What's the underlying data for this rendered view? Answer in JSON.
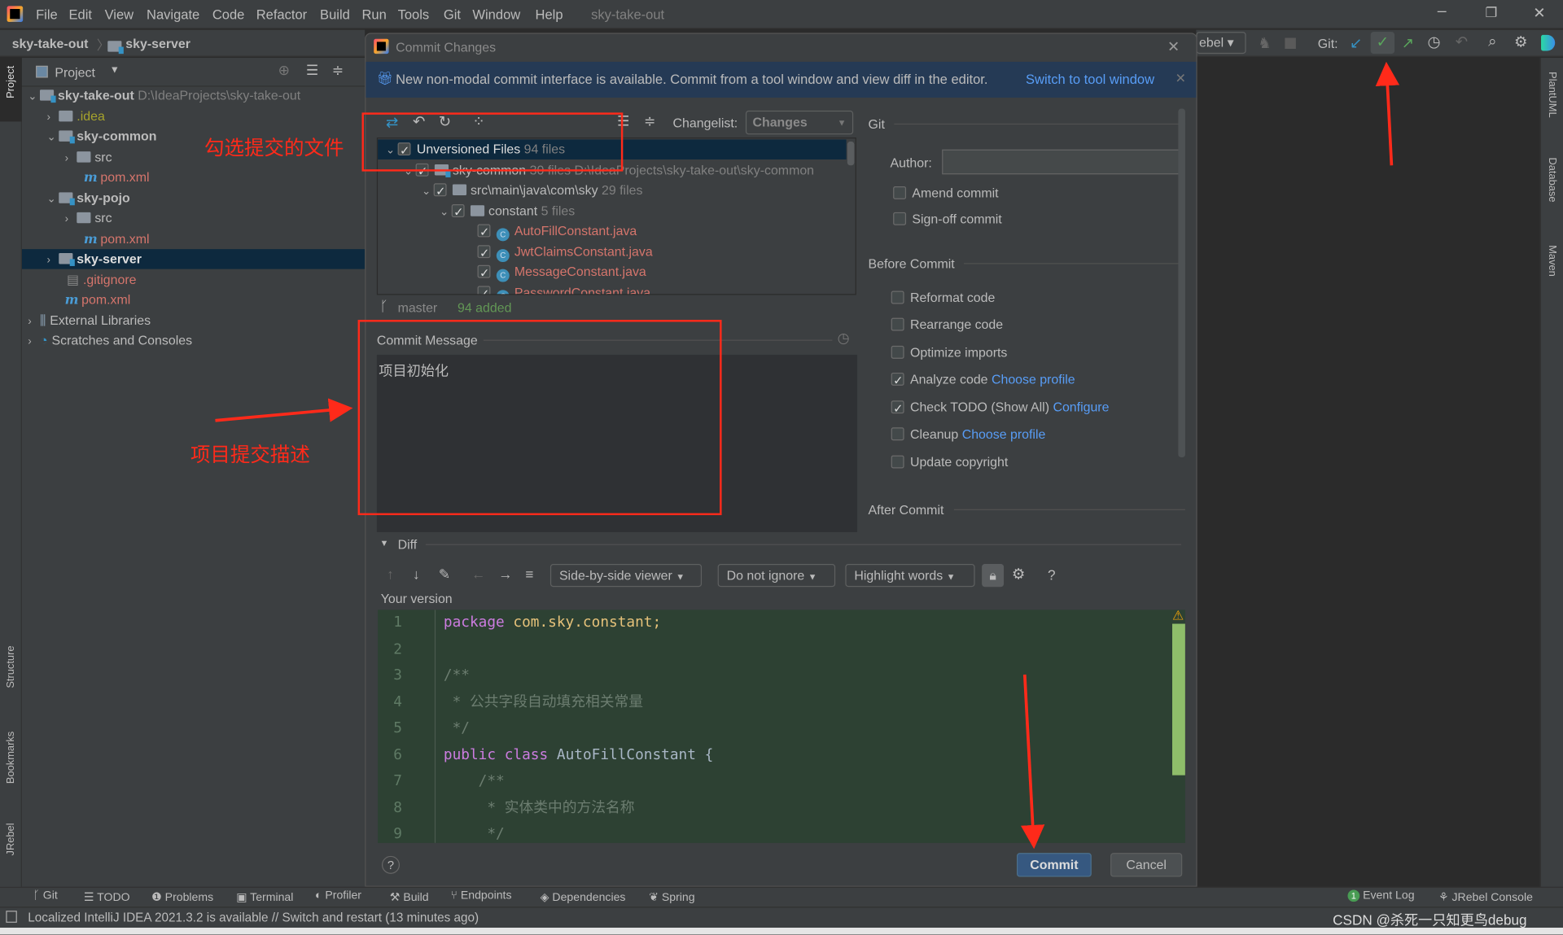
{
  "menubar": {
    "items": [
      "File",
      "Edit",
      "View",
      "Navigate",
      "Code",
      "Refactor",
      "Build",
      "Run",
      "Tools",
      "Git",
      "Window",
      "Help"
    ],
    "project_title": "sky-take-out"
  },
  "breadcrumb": {
    "root": "sky-take-out",
    "module": "sky-server"
  },
  "toolbar": {
    "run_config": "ebel",
    "git_label": "Git:"
  },
  "left_stripe": {
    "project": "Project",
    "structure": "Structure",
    "bookmarks": "Bookmarks",
    "jrebel": "JRebel"
  },
  "right_stripe": {
    "plantuml": "PlantUML",
    "database": "Database",
    "maven": "Maven"
  },
  "project_panel": {
    "title": "Project",
    "tree": [
      {
        "label": "sky-take-out",
        "path": "D:\\IdeaProjects\\sky-take-out"
      },
      {
        "label": ".idea"
      },
      {
        "label": "sky-common"
      },
      {
        "label": "src"
      },
      {
        "label": "pom.xml"
      },
      {
        "label": "sky-pojo"
      },
      {
        "label": "src"
      },
      {
        "label": "pom.xml"
      },
      {
        "label": "sky-server"
      },
      {
        "label": ".gitignore"
      },
      {
        "label": "pom.xml"
      },
      {
        "label": "External Libraries"
      },
      {
        "label": "Scratches and Consoles"
      }
    ]
  },
  "dialog": {
    "title": "Commit Changes",
    "banner": {
      "text": "New non-modal commit interface is available. Commit from a tool window and view diff in the editor.",
      "link": "Switch to tool window"
    },
    "changelist_label": "Changelist:",
    "changelist_value": "Changes",
    "changes_tree": [
      {
        "label": "Unversioned Files",
        "meta": "94 files",
        "checked": true
      },
      {
        "label": "sky-common",
        "meta": "30 files  D:\\IdeaProjects\\sky-take-out\\sky-common",
        "checked": true
      },
      {
        "label": "src\\main\\java\\com\\sky",
        "meta": "29 files",
        "checked": true
      },
      {
        "label": "constant",
        "meta": "5 files",
        "checked": true
      },
      {
        "label": "AutoFillConstant.java",
        "checked": true
      },
      {
        "label": "JwtClaimsConstant.java",
        "checked": true
      },
      {
        "label": "MessageConstant.java",
        "checked": true
      },
      {
        "label": "PasswordConstant.java",
        "checked": true
      }
    ],
    "branch": "master",
    "added": "94 added",
    "commit_message_label": "Commit Message",
    "commit_message": "项目初始化",
    "git_section": "Git",
    "author_label": "Author:",
    "author_value": "",
    "git_options": [
      {
        "label": "Amend commit",
        "checked": false
      },
      {
        "label": "Sign-off commit",
        "checked": false
      }
    ],
    "before_commit": "Before Commit",
    "before_options": [
      {
        "label": "Reformat code",
        "checked": false,
        "link": ""
      },
      {
        "label": "Rearrange code",
        "checked": false,
        "link": ""
      },
      {
        "label": "Optimize imports",
        "checked": false,
        "link": ""
      },
      {
        "label": "Analyze code",
        "checked": true,
        "link": "Choose profile"
      },
      {
        "label": "Check TODO (Show All)",
        "checked": true,
        "link": "Configure"
      },
      {
        "label": "Cleanup",
        "checked": false,
        "link": "Choose profile"
      },
      {
        "label": "Update copyright",
        "checked": false,
        "link": ""
      }
    ],
    "after_commit": "After Commit",
    "diff": {
      "title": "Diff",
      "viewer": "Side-by-side viewer",
      "ignore": "Do not ignore",
      "highlight": "Highlight words",
      "your_version": "Your version",
      "lines": [
        "package com.sky.constant;",
        "",
        "/**",
        " * 公共字段自动填充相关常量",
        " */",
        "public class AutoFillConstant {",
        "    /**",
        "     * 实体类中的方法名称",
        "     */"
      ]
    },
    "commit_button": "Commit",
    "cancel_button": "Cancel"
  },
  "tool_windows": [
    "Git",
    "TODO",
    "Problems",
    "Terminal",
    "Profiler",
    "Build",
    "Endpoints",
    "Dependencies",
    "Spring"
  ],
  "tool_windows_right": [
    {
      "label": "Event Log",
      "badge": "1"
    },
    {
      "label": "JRebel Console"
    }
  ],
  "status_bar": {
    "text": "Localized IntelliJ IDEA 2021.3.2 is available // Switch and restart (13 minutes ago)",
    "watermark": "CSDN @杀死一只知更鸟debug"
  },
  "annotations": {
    "select_files": "勾选提交的文件",
    "commit_desc": "项目提交描述"
  },
  "colors": {
    "annotation": "#ff2a1a",
    "link": "#589df6",
    "unversioned": "#d5756c",
    "added": "#629755",
    "commit_button": "#365880"
  }
}
